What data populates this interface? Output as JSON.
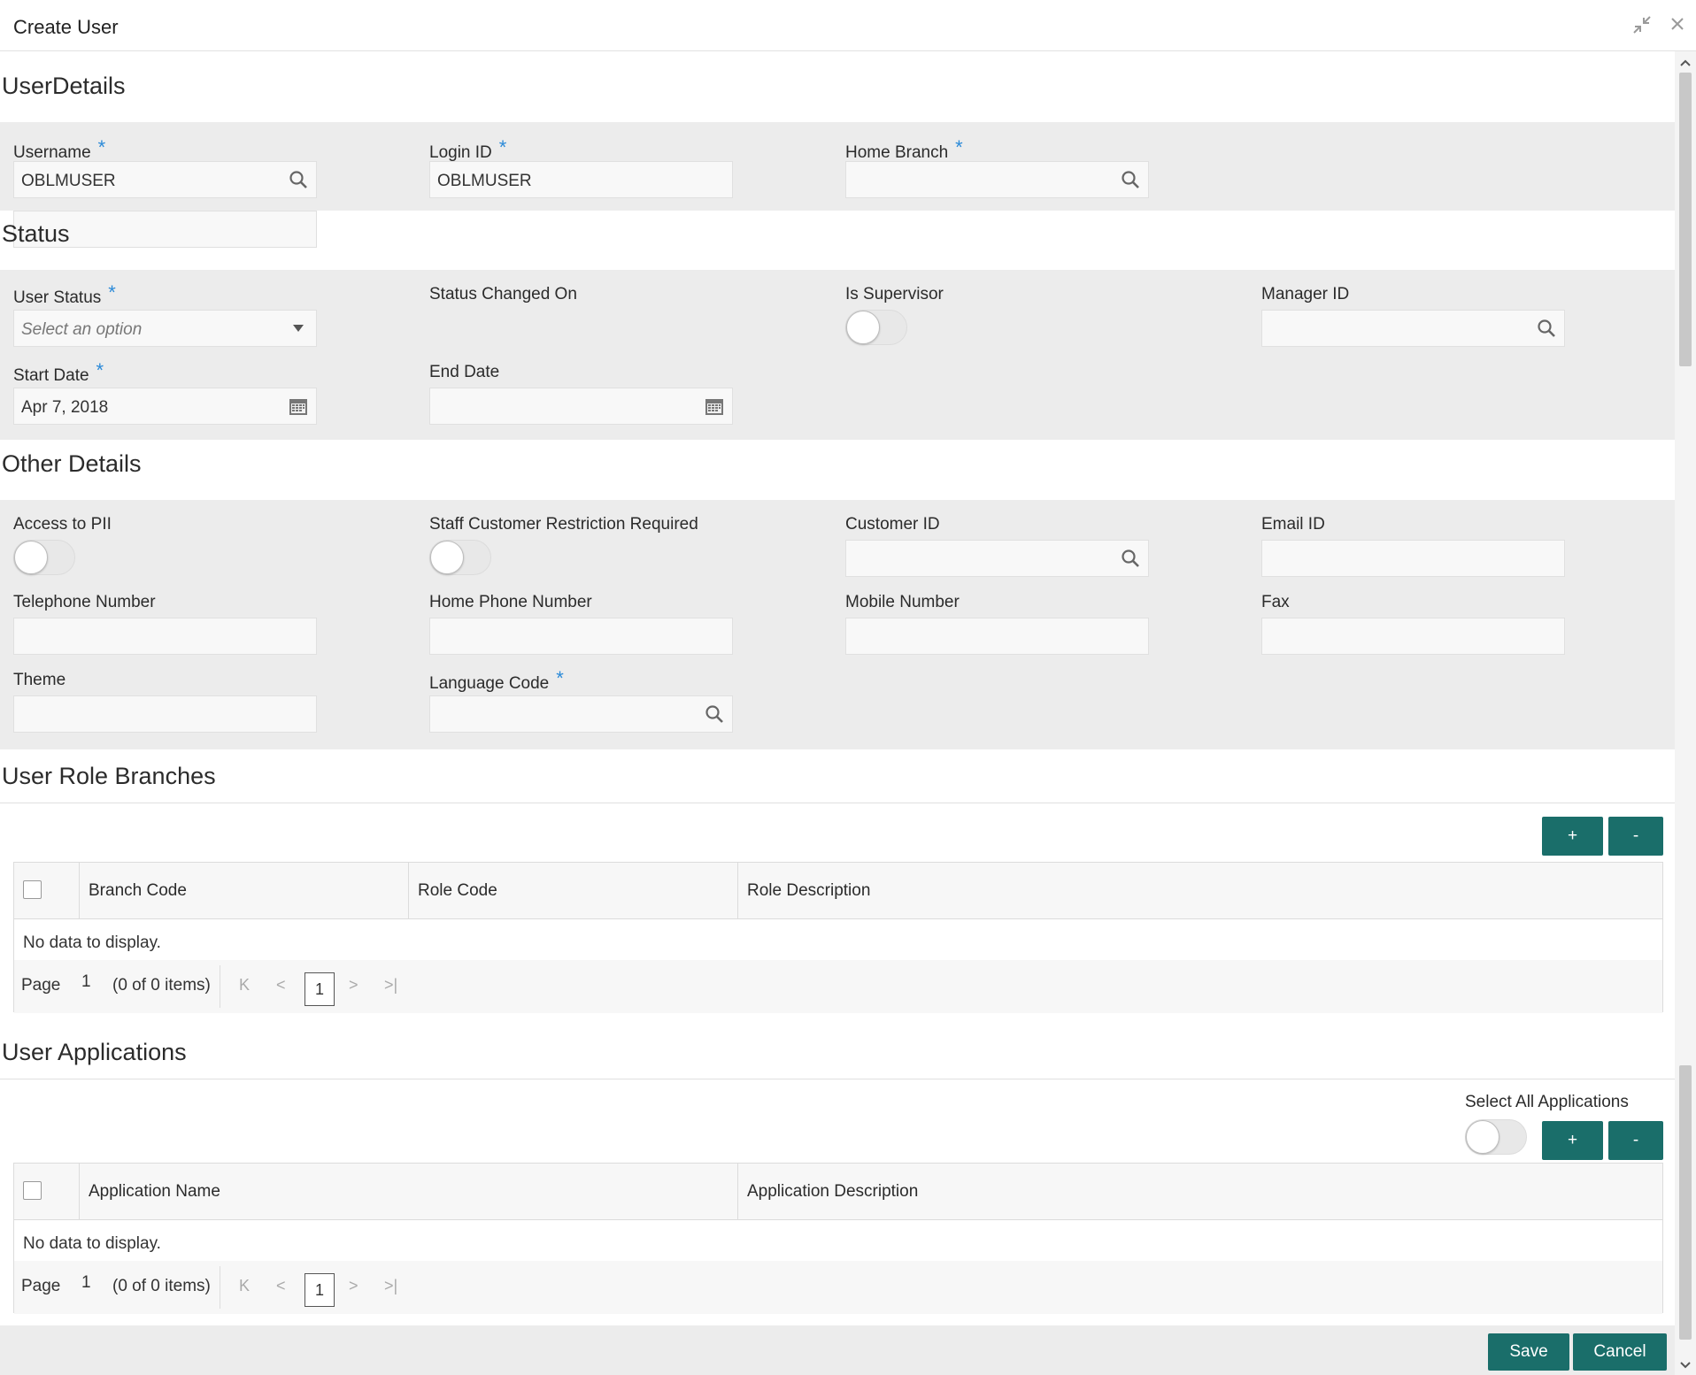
{
  "window": {
    "title": "Create User",
    "minimize_icon": "collapse-arrows-icon",
    "close_icon": "close-icon"
  },
  "user_details": {
    "heading": "UserDetails",
    "username": {
      "label": "Username",
      "value": "OBLMUSER"
    },
    "login_id": {
      "label": "Login ID",
      "value": "OBLMUSER"
    },
    "home_branch": {
      "label": "Home Branch",
      "value": ""
    },
    "required_mark": "*"
  },
  "status": {
    "heading": "Status",
    "user_status": {
      "label": "User Status",
      "placeholder": "Select an option"
    },
    "status_changed_on": {
      "label": "Status Changed On"
    },
    "is_supervisor": {
      "label": "Is Supervisor",
      "on": false
    },
    "manager_id": {
      "label": "Manager ID",
      "value": ""
    },
    "start_date": {
      "label": "Start Date",
      "value": "Apr 7, 2018"
    },
    "end_date": {
      "label": "End Date",
      "value": ""
    }
  },
  "other_details": {
    "heading": "Other Details",
    "access_pii": {
      "label": "Access to PII",
      "on": false
    },
    "staff_restriction": {
      "label": "Staff Customer Restriction Required",
      "on": false
    },
    "customer_id": {
      "label": "Customer ID",
      "value": ""
    },
    "email_id": {
      "label": "Email ID",
      "value": ""
    },
    "telephone": {
      "label": "Telephone Number",
      "value": ""
    },
    "home_phone": {
      "label": "Home Phone Number",
      "value": ""
    },
    "mobile": {
      "label": "Mobile Number",
      "value": ""
    },
    "fax": {
      "label": "Fax",
      "value": ""
    },
    "theme": {
      "label": "Theme",
      "value": ""
    },
    "language_code": {
      "label": "Language Code",
      "value": ""
    }
  },
  "role_branches": {
    "heading": "User Role Branches",
    "add_label": "+",
    "remove_label": "-",
    "columns": [
      "Branch Code",
      "Role Code",
      "Role Description"
    ],
    "empty_text": "No data to display.",
    "pager": {
      "page_label": "Page",
      "page_value": "1",
      "items_text": "(0 of 0 items)",
      "current_page": "1"
    }
  },
  "applications": {
    "heading": "User Applications",
    "select_all_label": "Select All Applications",
    "select_all_on": false,
    "add_label": "+",
    "remove_label": "-",
    "columns": [
      "Application Name",
      "Application Description"
    ],
    "empty_text": "No data to display.",
    "pager": {
      "page_label": "Page",
      "page_value": "1",
      "items_text": "(0 of 0 items)",
      "current_page": "1"
    }
  },
  "footer": {
    "save_label": "Save",
    "cancel_label": "Cancel"
  },
  "colors": {
    "accent": "#1a6e6a",
    "required": "#2b8ad8",
    "panel_bg": "#ececec"
  },
  "icons": {
    "search": "search-icon",
    "dropdown": "caret-down-icon",
    "calendar": "calendar-icon"
  }
}
